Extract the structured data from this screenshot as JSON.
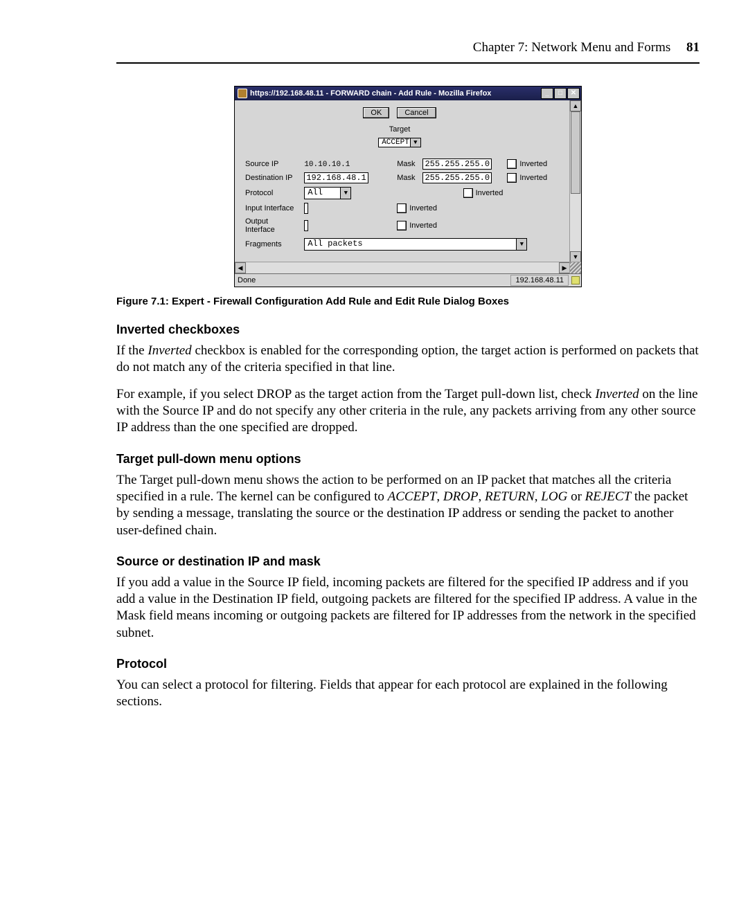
{
  "header": {
    "running": "Chapter 7: Network Menu and Forms",
    "page_number": "81"
  },
  "screenshot": {
    "titlebar": "https://192.168.48.11 - FORWARD chain - Add Rule - Mozilla Firefox",
    "buttons": {
      "ok": "OK",
      "cancel": "Cancel"
    },
    "target_label": "Target",
    "target_value": "ACCEPT",
    "rows": {
      "source_ip": {
        "label": "Source IP",
        "value": "10.10.10.1",
        "mask_label": "Mask",
        "mask_value": "255.255.255.0",
        "inverted_label": "Inverted"
      },
      "dest_ip": {
        "label": "Destination IP",
        "value": "192.168.48.1",
        "mask_label": "Mask",
        "mask_value": "255.255.255.0",
        "inverted_label": "Inverted"
      },
      "protocol": {
        "label": "Protocol",
        "value": "All",
        "inverted_label": "Inverted"
      },
      "in_if": {
        "label": "Input Interface",
        "value": "",
        "inverted_label": "Inverted"
      },
      "out_if": {
        "label": "Output Interface",
        "value": "",
        "inverted_label": "Inverted"
      },
      "fragments": {
        "label": "Fragments",
        "value": "All packets"
      }
    },
    "status_left": "Done",
    "status_right": "192.168.48.11"
  },
  "caption": "Figure 7.1: Expert - Firewall Configuration Add Rule and Edit Rule Dialog Boxes",
  "sections": {
    "inverted": {
      "heading": "Inverted checkboxes",
      "p1a": "If the ",
      "p1b": "Inverted",
      "p1c": " checkbox is enabled for the corresponding option, the target action is performed on packets that do not match any of the criteria specified in that line.",
      "p2a": "For example, if you select DROP as the target action from the Target pull-down list, check ",
      "p2b": "Inverted",
      "p2c": " on the line with the Source IP and do not specify any other criteria in the rule, any packets arriving from any other source IP address than the one specified are dropped."
    },
    "target": {
      "heading": "Target pull-down menu options",
      "p_a": "The Target pull-down menu shows the action to be performed on an IP packet that matches all the criteria specified in a rule. The kernel can be configured to ",
      "w1": "ACCEPT",
      "s1": ", ",
      "w2": "DROP",
      "s2": ", ",
      "w3": "RETURN",
      "s3": ", ",
      "w4": "LOG",
      "s4": " or ",
      "w5": "REJECT",
      "p_b": " the packet by sending a message, translating the source or the destination IP address or sending the packet to another user-defined chain."
    },
    "ipmask": {
      "heading": "Source or destination IP and mask",
      "p": "If you add a value in the Source IP field, incoming packets are filtered for the specified IP address and if you add a value in the Destination IP field, outgoing packets are filtered for the specified IP address. A value in the Mask field means incoming or outgoing packets are filtered for IP addresses from the network in the specified subnet."
    },
    "protocol": {
      "heading": "Protocol",
      "p": "You can select a protocol for filtering. Fields that appear for each protocol are explained in the following sections."
    }
  }
}
